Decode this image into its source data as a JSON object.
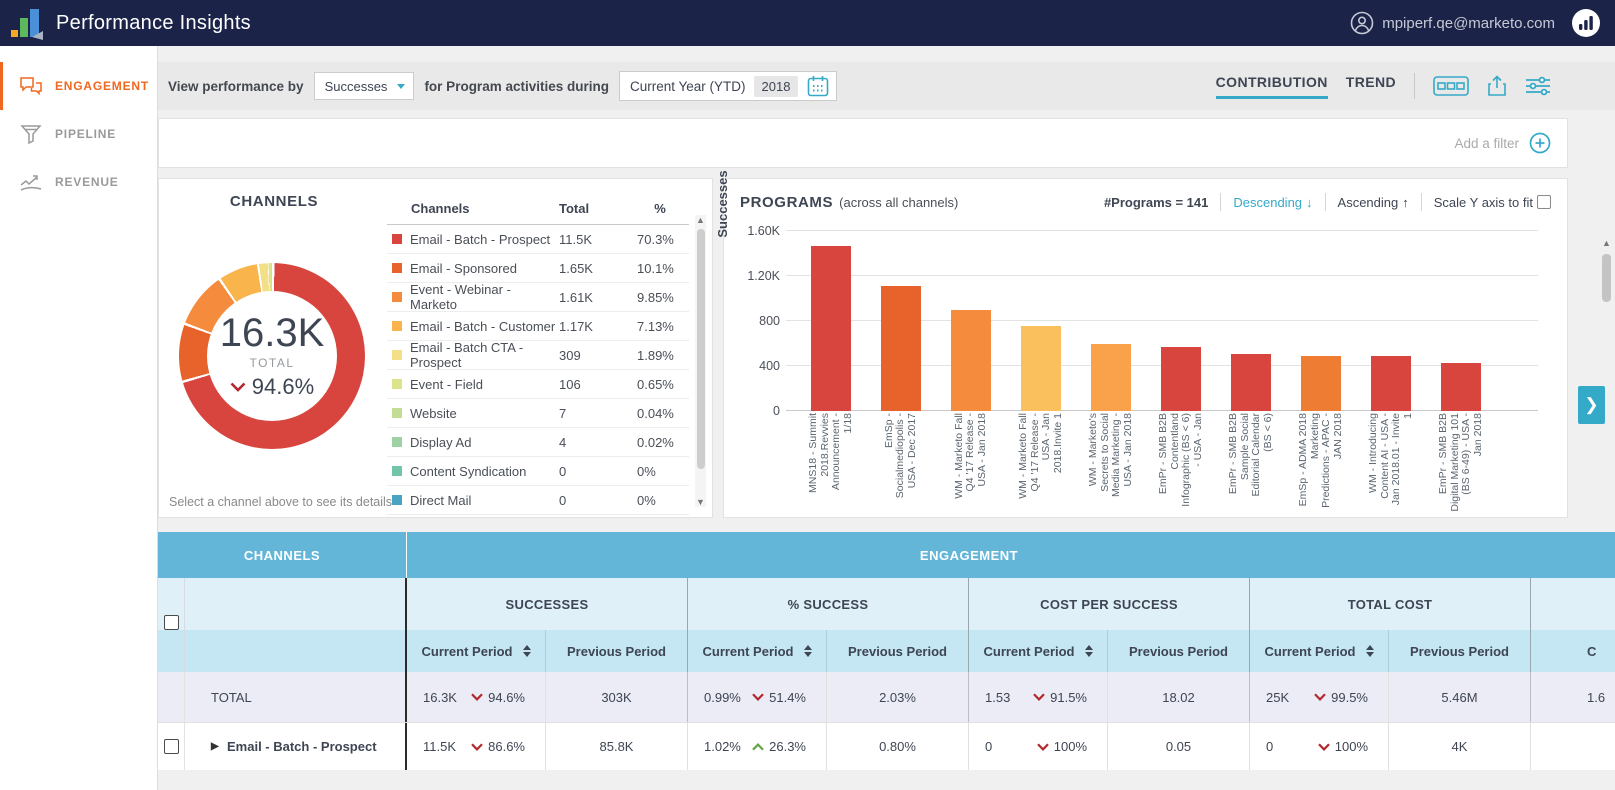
{
  "topnav": {
    "title": "Performance Insights",
    "user_email": "mpiperf.qe@marketo.com"
  },
  "sidebar": {
    "items": [
      {
        "label": "ENGAGEMENT",
        "active": true
      },
      {
        "label": "PIPELINE",
        "active": false
      },
      {
        "label": "REVENUE",
        "active": false
      }
    ]
  },
  "toolbar": {
    "view_by_label": "View performance by",
    "view_by_value": "Successes",
    "during_label": "for Program activities during",
    "period_name": "Current Year (YTD)",
    "period_year": "2018",
    "tabs": [
      {
        "label": "CONTRIBUTION",
        "active": true
      },
      {
        "label": "TREND",
        "active": false
      }
    ]
  },
  "filter_bar": {
    "add_filter_label": "Add a filter"
  },
  "channels_panel": {
    "title": "CHANNELS",
    "total_value": "16.3K",
    "total_label": "TOTAL",
    "total_change": "94.6%",
    "total_change_direction": "down",
    "footnote": "Select a channel above to see its details",
    "headers": {
      "name": "Channels",
      "total": "Total",
      "percent": "%"
    },
    "rows": [
      {
        "name": "Email - Batch - Prospect",
        "total": "11.5K",
        "percent": "70.3%",
        "color": "#d8453e"
      },
      {
        "name": "Email - Sponsored",
        "total": "1.65K",
        "percent": "10.1%",
        "color": "#e8622c"
      },
      {
        "name": "Event - Webinar - Marketo",
        "total": "1.61K",
        "percent": "9.85%",
        "color": "#f58b3c"
      },
      {
        "name": "Email - Batch - Customer",
        "total": "1.17K",
        "percent": "7.13%",
        "color": "#f9b54c"
      },
      {
        "name": "Email - Batch CTA - Prospect",
        "total": "309",
        "percent": "1.89%",
        "color": "#f3df87"
      },
      {
        "name": "Event - Field",
        "total": "106",
        "percent": "0.65%",
        "color": "#dbe48b"
      },
      {
        "name": "Website",
        "total": "7",
        "percent": "0.04%",
        "color": "#c3dc96"
      },
      {
        "name": "Display Ad",
        "total": "4",
        "percent": "0.02%",
        "color": "#9ed2a4"
      },
      {
        "name": "Content Syndication",
        "total": "0",
        "percent": "0%",
        "color": "#72c6a7"
      },
      {
        "name": "Direct Mail",
        "total": "0",
        "percent": "0%",
        "color": "#4aa3c0"
      }
    ]
  },
  "programs_panel": {
    "title": "PROGRAMS",
    "subtitle": "(across all channels)",
    "programs_count": "#Programs = 141",
    "sort_descending": "Descending",
    "sort_ascending": "Ascending",
    "scale_label": "Scale Y axis to fit"
  },
  "chart_data": [
    {
      "type": "pie",
      "title": "CHANNELS",
      "labels": [
        "Email - Batch - Prospect",
        "Email - Sponsored",
        "Event - Webinar - Marketo",
        "Email - Batch - Customer",
        "Email - Batch CTA - Prospect",
        "Event - Field",
        "Website",
        "Display Ad",
        "Content Syndication",
        "Direct Mail"
      ],
      "values": [
        70.3,
        10.1,
        9.85,
        7.13,
        1.89,
        0.65,
        0.04,
        0.02,
        0,
        0
      ],
      "colors": [
        "#d8453e",
        "#e8622c",
        "#f58b3c",
        "#f9b54c",
        "#f3df87",
        "#dbe48b",
        "#c3dc96",
        "#9ed2a4",
        "#72c6a7",
        "#4aa3c0"
      ],
      "center_total": "16.3K",
      "center_change": "-94.6%",
      "donut": true
    },
    {
      "type": "bar",
      "title": "PROGRAMS (across all channels)",
      "xlabel": "",
      "ylabel": "Successes",
      "ylim": [
        0,
        1600
      ],
      "yticks": [
        {
          "value": 0,
          "label": "0"
        },
        {
          "value": 400,
          "label": "400"
        },
        {
          "value": 800,
          "label": "800"
        },
        {
          "value": 1200,
          "label": "1.20K"
        },
        {
          "value": 1600,
          "label": "1.60K"
        }
      ],
      "categories": [
        "MNS18 - Summit 2018.Revvies Announcement - 1/18",
        "EmSp - Socialmediopolis - USA - Dec 2017",
        "WM - Marketo Fall Q4 '17 Release - USA - Jan 2018",
        "WM - Marketo Fall Q4 '17 Release - USA - Jan 2018.Invite 1",
        "WM - Marketo's Secrets to Social Media Marketing - USA - Jan 2018",
        "EmPr - SMB B2B Contentland Infographic (BS < 6) - USA - Jan",
        "EmPr - SMB B2B Sample Social Editorial Calendar (BS < 6)",
        "EmSp - ADMA 2018 Marketing Predictions - APAC - JAN 2018",
        "WM - Introducing Content AI - USA - Jan 2018.01 - Invite 1",
        "EmPr - SMB B2B Digital Marketing 101 (BS 6-49) - USA - Jan 2018"
      ],
      "values": [
        1470,
        1115,
        895,
        755,
        595,
        570,
        505,
        490,
        490,
        425
      ],
      "colors": [
        "#d8453e",
        "#e8622c",
        "#f58b3c",
        "#fbc05e",
        "#f9a14b",
        "#d8453e",
        "#d8453e",
        "#ee7c33",
        "#d8453e",
        "#d8453e"
      ],
      "grid": true,
      "legend": false
    }
  ],
  "bottom_table": {
    "left_header": "CHANNELS",
    "right_header": "ENGAGEMENT",
    "groups": [
      "SUCCESSES",
      "% SUCCESS",
      "COST PER SUCCESS",
      "TOTAL COST"
    ],
    "sub_current": "Current Period",
    "sub_previous": "Previous Period",
    "partial_column": {
      "subheader": "C",
      "total_value": "1.6"
    },
    "total_row": {
      "label": "TOTAL",
      "cells": [
        {
          "current": "16.3K",
          "change": "94.6%",
          "direction": "down",
          "previous": "303K"
        },
        {
          "current": "0.99%",
          "change": "51.4%",
          "direction": "down",
          "previous": "2.03%"
        },
        {
          "current": "1.53",
          "change": "91.5%",
          "direction": "down",
          "previous": "18.02"
        },
        {
          "current": "25K",
          "change": "99.5%",
          "direction": "down",
          "previous": "5.46M"
        }
      ]
    },
    "rows": [
      {
        "label": "Email - Batch - Prospect",
        "cells": [
          {
            "current": "11.5K",
            "change": "86.6%",
            "direction": "down",
            "previous": "85.8K"
          },
          {
            "current": "1.02%",
            "change": "26.3%",
            "direction": "up",
            "previous": "0.80%"
          },
          {
            "current": "0",
            "change": "100%",
            "direction": "down",
            "previous": "0.05"
          },
          {
            "current": "0",
            "change": "100%",
            "direction": "down",
            "previous": "4K"
          }
        ]
      }
    ]
  }
}
